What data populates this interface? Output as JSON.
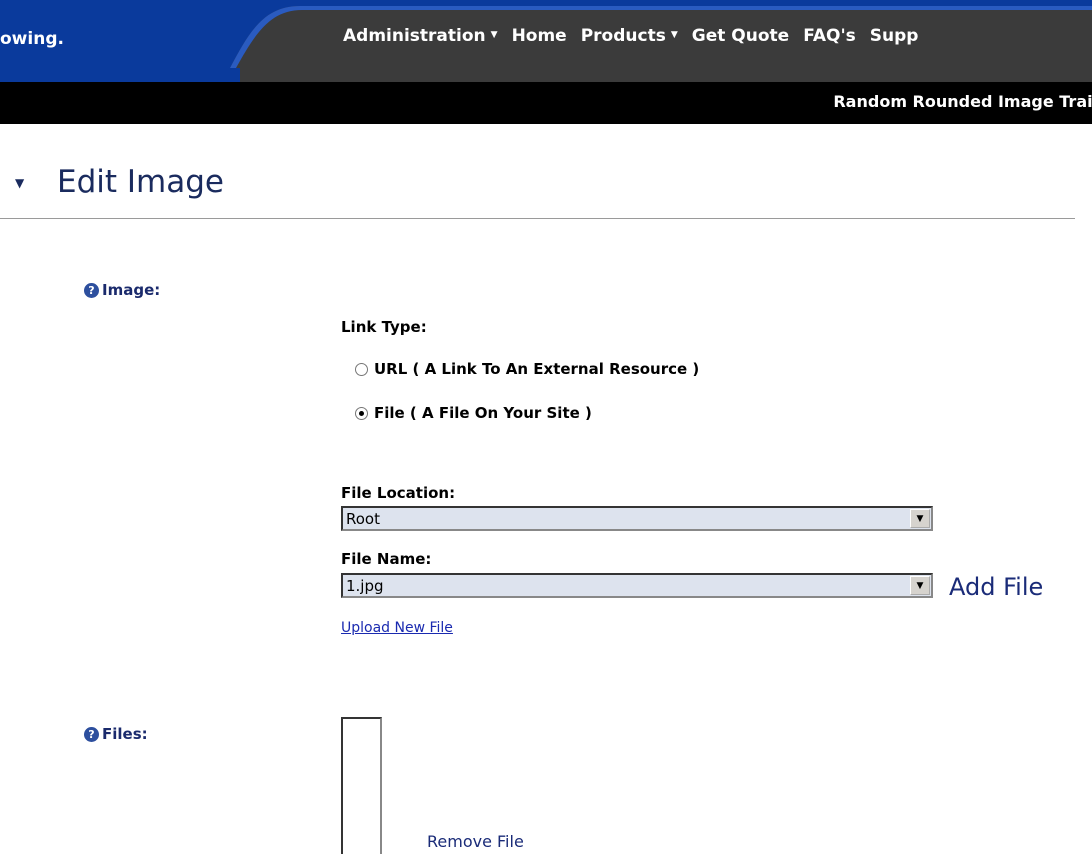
{
  "nav": {
    "left_text": "owing.",
    "menu": [
      {
        "label": "Administration",
        "caret": "▼"
      },
      {
        "label": "Home",
        "caret": ""
      },
      {
        "label": "Products",
        "caret": "▼"
      },
      {
        "label": "Get Quote",
        "caret": ""
      },
      {
        "label": "FAQ's",
        "caret": ""
      },
      {
        "label": "Supp",
        "caret": ""
      }
    ],
    "site_title": "Random Rounded Image Train"
  },
  "section": {
    "toggle_icon": "▼",
    "title": "Edit Image"
  },
  "form": {
    "image_label": "Image:",
    "help_icon": "?",
    "link_type_label": "Link Type:",
    "radio_url": "URL ( A Link To An External Resource )",
    "radio_file": "File ( A File On Your Site )",
    "selected_link_type": "file",
    "file_location_label": "File Location:",
    "file_location_value": "Root",
    "file_name_label": "File Name:",
    "file_name_value": "1.jpg",
    "add_file": "Add File",
    "upload_new_file": "Upload New File",
    "files_label": "Files:",
    "remove_file": "Remove File"
  },
  "colors": {
    "nav_blue": "#0a3a9c",
    "nav_dark": "#3b3b3b",
    "heading": "#1a2b5e",
    "label": "#1a2a6c"
  }
}
